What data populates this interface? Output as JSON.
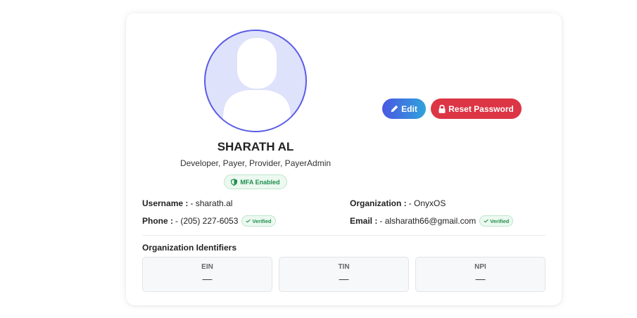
{
  "profile": {
    "name": "SHARATH AL",
    "roles": "Developer, Payer, Provider, PayerAdmin",
    "mfa_badge": "MFA Enabled"
  },
  "actions": {
    "edit_label": "Edit",
    "reset_label": "Reset Password"
  },
  "fields": {
    "username_label": "Username :",
    "username_value": "- sharath.al",
    "phone_label": "Phone :",
    "phone_value": "- (205) 227-6053",
    "phone_verified": "Verified",
    "organization_label": "Organization :",
    "organization_value": "- OnyxOS",
    "email_label": "Email :",
    "email_value": "- alsharath66@gmail.com",
    "email_verified": "Verified"
  },
  "org_identifiers": {
    "title": "Organization Identifiers",
    "items": [
      {
        "label": "EIN",
        "value": "—"
      },
      {
        "label": "TIN",
        "value": "—"
      },
      {
        "label": "NPI",
        "value": "—"
      }
    ]
  },
  "colors": {
    "avatar_border": "#5a5ce6",
    "avatar_bg": "#dfe2fb",
    "edit_gradient_start": "#4a58e2",
    "edit_gradient_end": "#2fa2dc",
    "reset_bg": "#dc3545",
    "verified_text": "#1f8f4e"
  },
  "icons": {
    "avatar": "user-silhouette-icon",
    "mfa": "shield-icon",
    "edit": "pencil-icon",
    "reset": "lock-icon",
    "verified": "check-icon"
  }
}
